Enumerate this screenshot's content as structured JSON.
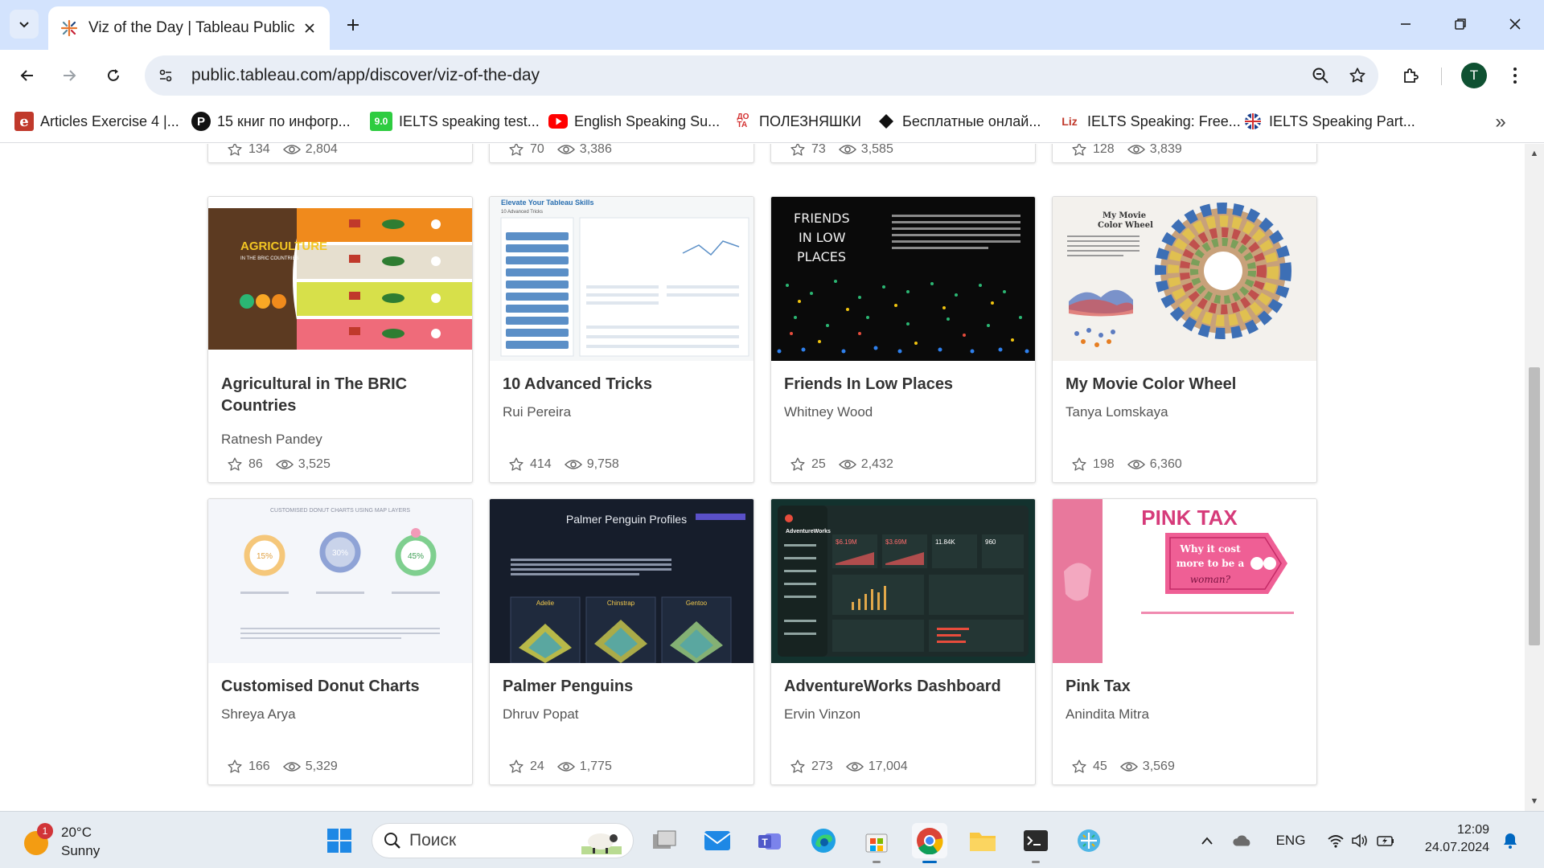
{
  "browser": {
    "tab": {
      "title": "Viz of the Day | Tableau Public"
    },
    "url": "public.tableau.com/app/discover/viz-of-the-day",
    "profile_initial": "T"
  },
  "bookmarks": [
    {
      "label": "Articles Exercise 4 |...",
      "icon": "e"
    },
    {
      "label": "15 книг по инфогр...",
      "icon": "P"
    },
    {
      "label": "IELTS speaking test...",
      "icon": "9.0"
    },
    {
      "label": "English Speaking Su...",
      "icon": "youtube"
    },
    {
      "label": "ПОЛЕЗНЯШКИ",
      "icon": "ДО ТА"
    },
    {
      "label": "Бесплатные онлай...",
      "icon": "diamond"
    },
    {
      "label": "IELTS Speaking: Free...",
      "icon": "Liz"
    },
    {
      "label": "IELTS Speaking Part...",
      "icon": "flag"
    }
  ],
  "top_row_stats": [
    {
      "favorites": "134",
      "views": "2,804"
    },
    {
      "favorites": "70",
      "views": "3,386"
    },
    {
      "favorites": "73",
      "views": "3,585"
    },
    {
      "favorites": "128",
      "views": "3,839"
    }
  ],
  "cards": [
    {
      "title": "Agricultural in The BRIC Countries",
      "author": "Ratnesh Pandey",
      "favorites": "86",
      "views": "3,525",
      "thumb_text": [
        "AGRICULTURE",
        "IN THE BRIC COUNTRIES"
      ]
    },
    {
      "title": "10 Advanced Tricks",
      "author": "Rui Pereira",
      "favorites": "414",
      "views": "9,758",
      "thumb_text": [
        "Elevate Your Tableau Skills",
        "10 Advanced Tricks"
      ]
    },
    {
      "title": "Friends In Low Places",
      "author": "Whitney Wood",
      "favorites": "25",
      "views": "2,432",
      "thumb_text": [
        "FRIENDS",
        "IN LOW",
        "PLACES"
      ]
    },
    {
      "title": "My Movie Color Wheel",
      "author": "Tanya Lomskaya",
      "favorites": "198",
      "views": "6,360",
      "thumb_text": [
        "My Movie",
        "Color Wheel"
      ]
    },
    {
      "title": "Customised Donut Charts",
      "author": "Shreya Arya",
      "favorites": "166",
      "views": "5,329",
      "thumb_text": [
        "CUSTOMISED DONUT CHARTS USING MAP LAYERS",
        "15%",
        "30%",
        "45%"
      ]
    },
    {
      "title": "Palmer Penguins",
      "author": "Dhruv Popat",
      "favorites": "24",
      "views": "1,775",
      "thumb_text": [
        "Palmer Penguin Profiles",
        "Adelie",
        "Chinstrap",
        "Gentoo"
      ]
    },
    {
      "title": "AdventureWorks Dashboard",
      "author": "Ervin Vinzon",
      "favorites": "273",
      "views": "17,004",
      "thumb_text": [
        "AdventureWorks",
        "$6.19M",
        "$3.69M",
        "11.84K",
        "960"
      ]
    },
    {
      "title": "Pink Tax",
      "author": "Anindita Mitra",
      "favorites": "45",
      "views": "3,569",
      "thumb_text": [
        "PINK TAX",
        "Why it cost",
        "more to be a",
        "woman?"
      ]
    }
  ],
  "taskbar": {
    "weather": {
      "temp": "20°C",
      "condition": "Sunny",
      "badge": "1"
    },
    "search_placeholder": "Поиск",
    "language": "ENG",
    "time": "12:09",
    "date": "24.07.2024"
  },
  "colors": {
    "tabstrip": "#d3e3fd",
    "omnibox": "#e9eef6",
    "taskbar": "#e6ecf2",
    "accent": "#0067c0"
  }
}
